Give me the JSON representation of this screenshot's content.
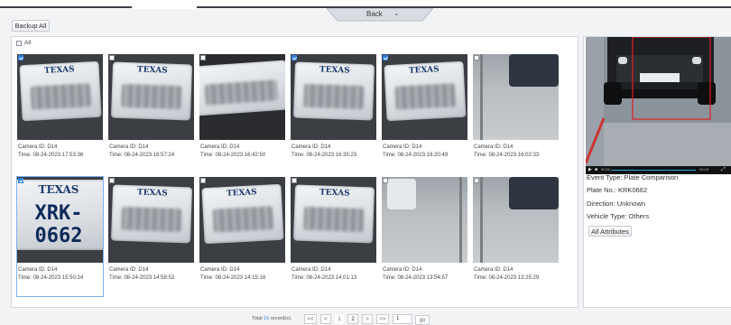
{
  "header": {
    "back_label": "Back",
    "backup_label": "Backup All"
  },
  "grid": {
    "select_all_label": "All",
    "cards": [
      {
        "camera": "Camera ID: D14",
        "time": "Time: 08-24-2023 17:53:36",
        "checked": true,
        "style": "plate",
        "state_text": "TEXAS",
        "plate_text": ""
      },
      {
        "camera": "Camera ID: D14",
        "time": "Time: 08-24-2023 16:57:24",
        "checked": false,
        "style": "plate",
        "state_text": "TEXAS",
        "plate_text": ""
      },
      {
        "camera": "Camera ID: D14",
        "time": "Time: 08-24-2023 16:42:50",
        "checked": false,
        "style": "dark-plate",
        "state_text": "",
        "plate_text": ""
      },
      {
        "camera": "Camera ID: D14",
        "time": "Time: 08-24-2023 16:35:23",
        "checked": true,
        "style": "plate",
        "state_text": "TEXAS",
        "plate_text": ""
      },
      {
        "camera": "Camera ID: D14",
        "time": "Time: 08-24-2023 16:20:49",
        "checked": true,
        "style": "plate",
        "state_text": "TEXAS",
        "plate_text": ""
      },
      {
        "camera": "Camera ID: D14",
        "time": "Time: 08-24-2023 16:02:33",
        "checked": false,
        "style": "car-street",
        "state_text": "",
        "plate_text": ""
      },
      {
        "camera": "Camera ID: D14",
        "time": "Time: 08-24-2023 15:50:14",
        "checked": true,
        "style": "plate-clear",
        "state_text": "TEXAS",
        "plate_text": "XRK-0662",
        "selected": true
      },
      {
        "camera": "Camera ID: D14",
        "time": "Time: 08-24-2023 14:58:53",
        "checked": false,
        "style": "plate",
        "state_text": "TEXAS",
        "plate_text": ""
      },
      {
        "camera": "Camera ID: D14",
        "time": "Time: 08-24-2023 14:15:18",
        "checked": false,
        "style": "plate",
        "state_text": "TEXAS",
        "plate_text": ""
      },
      {
        "camera": "Camera ID: D14",
        "time": "Time: 08-24-2023 14:01:13",
        "checked": false,
        "style": "plate-rough",
        "state_text": "TEXAS",
        "plate_text": ""
      },
      {
        "camera": "Camera ID: D14",
        "time": "Time: 08-24-2023 13:54:57",
        "checked": false,
        "style": "car-white",
        "state_text": "",
        "plate_text": ""
      },
      {
        "camera": "Camera ID: D14",
        "time": "Time: 08-24-2023 13:25:29",
        "checked": false,
        "style": "car-street",
        "state_text": "",
        "plate_text": ""
      }
    ]
  },
  "detail": {
    "time_start": "00:00",
    "time_end": "00:15",
    "event_type": "Event Type:   Plate Comparison",
    "plate_no": "Plate No.:   KRK0662",
    "direction": "Direction:   Unknown",
    "vehicle_type": "Vehicle Type:   Others",
    "all_attributes_label": "All Attributes"
  },
  "pager": {
    "total_prefix": "Total ",
    "total_count": "16",
    "total_suffix": " record(s).",
    "first": "<<",
    "prev": "<",
    "page1": "1",
    "page2": "2",
    "next": ">",
    "last": ">>",
    "page_input": "1",
    "go_label": "go"
  },
  "colors": {
    "accent": "#2d7fe8",
    "highlight_box": "#e02020",
    "progress": "#2aa6d9"
  }
}
